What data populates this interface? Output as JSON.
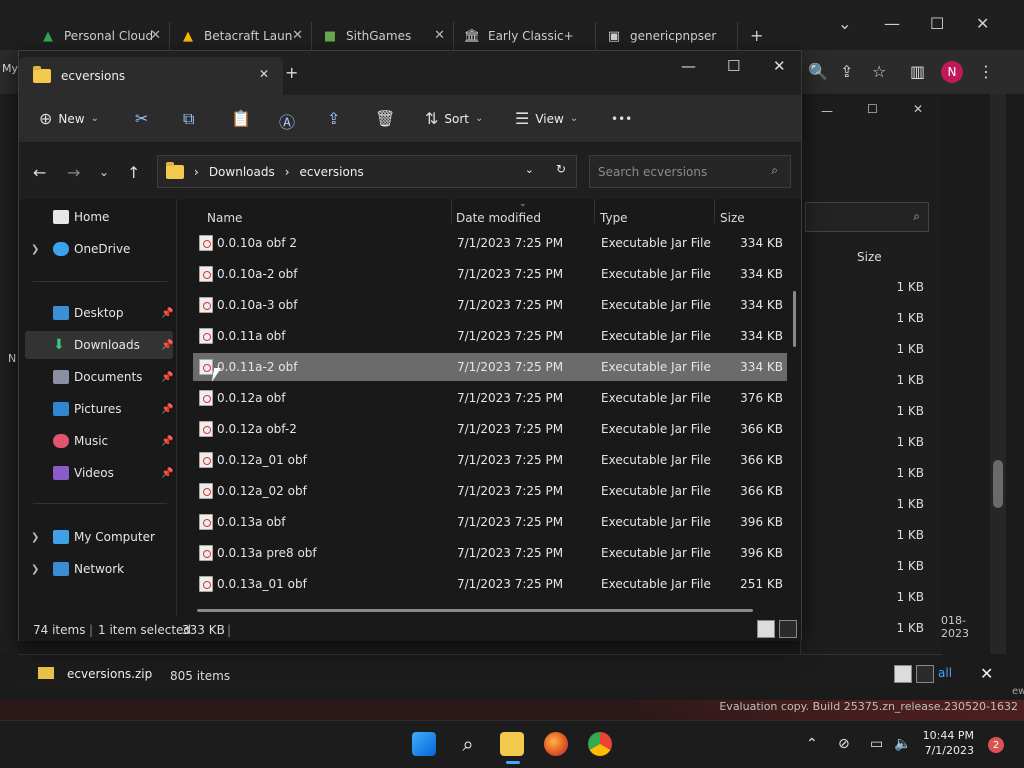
{
  "chrome": {
    "tabs": [
      {
        "label": "Personal Cloud",
        "icon": "drive-icon"
      },
      {
        "label": "Betacraft Laun",
        "icon": "drive-icon"
      },
      {
        "label": "SithGames",
        "icon": "minecraft-icon"
      },
      {
        "label": "Early Classic+",
        "icon": "bank-icon"
      },
      {
        "label": "genericpnpser",
        "icon": "page-icon"
      }
    ],
    "new_tab": "+",
    "avatar": "N",
    "left_fragments": [
      "My",
      "N"
    ]
  },
  "background_explorer": {
    "size_header": "Size",
    "sizes": [
      "1 KB",
      "1 KB",
      "1 KB",
      "1 KB",
      "1 KB",
      "1 KB",
      "1 KB",
      "1 KB",
      "1 KB",
      "1 KB",
      "1 KB",
      "1 KB"
    ],
    "date_fragment": "018-2023",
    "zip_name": "ecversions.zip",
    "items_count": "805 items",
    "all_label": "all",
    "view_fragment": "ew"
  },
  "explorer": {
    "tab_title": "ecversions",
    "new_tab": "+",
    "toolbar": {
      "new_label": "New",
      "sort_label": "Sort",
      "view_label": "View",
      "more": "•••"
    },
    "breadcrumb": [
      "Downloads",
      "ecversions"
    ],
    "search_placeholder": "Search ecversions",
    "sidebar": {
      "home": "Home",
      "onedrive": "OneDrive",
      "desktop": "Desktop",
      "downloads": "Downloads",
      "documents": "Documents",
      "pictures": "Pictures",
      "music": "Music",
      "videos": "Videos",
      "my_computer": "My Computer",
      "network": "Network"
    },
    "columns": {
      "name": "Name",
      "date": "Date modified",
      "type": "Type",
      "size": "Size"
    },
    "files": [
      {
        "name": "0.0.10a obf 2",
        "date": "7/1/2023 7:25 PM",
        "type": "Executable Jar File",
        "size": "334 KB"
      },
      {
        "name": "0.0.10a-2 obf",
        "date": "7/1/2023 7:25 PM",
        "type": "Executable Jar File",
        "size": "334 KB"
      },
      {
        "name": "0.0.10a-3 obf",
        "date": "7/1/2023 7:25 PM",
        "type": "Executable Jar File",
        "size": "334 KB"
      },
      {
        "name": "0.0.11a obf",
        "date": "7/1/2023 7:25 PM",
        "type": "Executable Jar File",
        "size": "334 KB"
      },
      {
        "name": "0.0.11a-2 obf",
        "date": "7/1/2023 7:25 PM",
        "type": "Executable Jar File",
        "size": "334 KB"
      },
      {
        "name": "0.0.12a obf",
        "date": "7/1/2023 7:25 PM",
        "type": "Executable Jar File",
        "size": "376 KB"
      },
      {
        "name": "0.0.12a obf-2",
        "date": "7/1/2023 7:25 PM",
        "type": "Executable Jar File",
        "size": "366 KB"
      },
      {
        "name": "0.0.12a_01 obf",
        "date": "7/1/2023 7:25 PM",
        "type": "Executable Jar File",
        "size": "366 KB"
      },
      {
        "name": "0.0.12a_02 obf",
        "date": "7/1/2023 7:25 PM",
        "type": "Executable Jar File",
        "size": "366 KB"
      },
      {
        "name": "0.0.13a obf",
        "date": "7/1/2023 7:25 PM",
        "type": "Executable Jar File",
        "size": "396 KB"
      },
      {
        "name": "0.0.13a pre8 obf",
        "date": "7/1/2023 7:25 PM",
        "type": "Executable Jar File",
        "size": "396 KB"
      },
      {
        "name": "0.0.13a_01 obf",
        "date": "7/1/2023 7:25 PM",
        "type": "Executable Jar File",
        "size": "251 KB"
      }
    ],
    "selected_index": 4,
    "status": {
      "items": "74 items",
      "selected": "1 item selected",
      "size": "333 KB"
    }
  },
  "desktop": {
    "watermark": "Evaluation copy. Build 25375.zn_release.230520-1632",
    "clock_time": "10:44 PM",
    "clock_date": "7/1/2023",
    "notifications": "2"
  },
  "colors": {
    "accent": "#0078d4",
    "selection": "#6b6b6b",
    "folder": "#f2c94c"
  }
}
